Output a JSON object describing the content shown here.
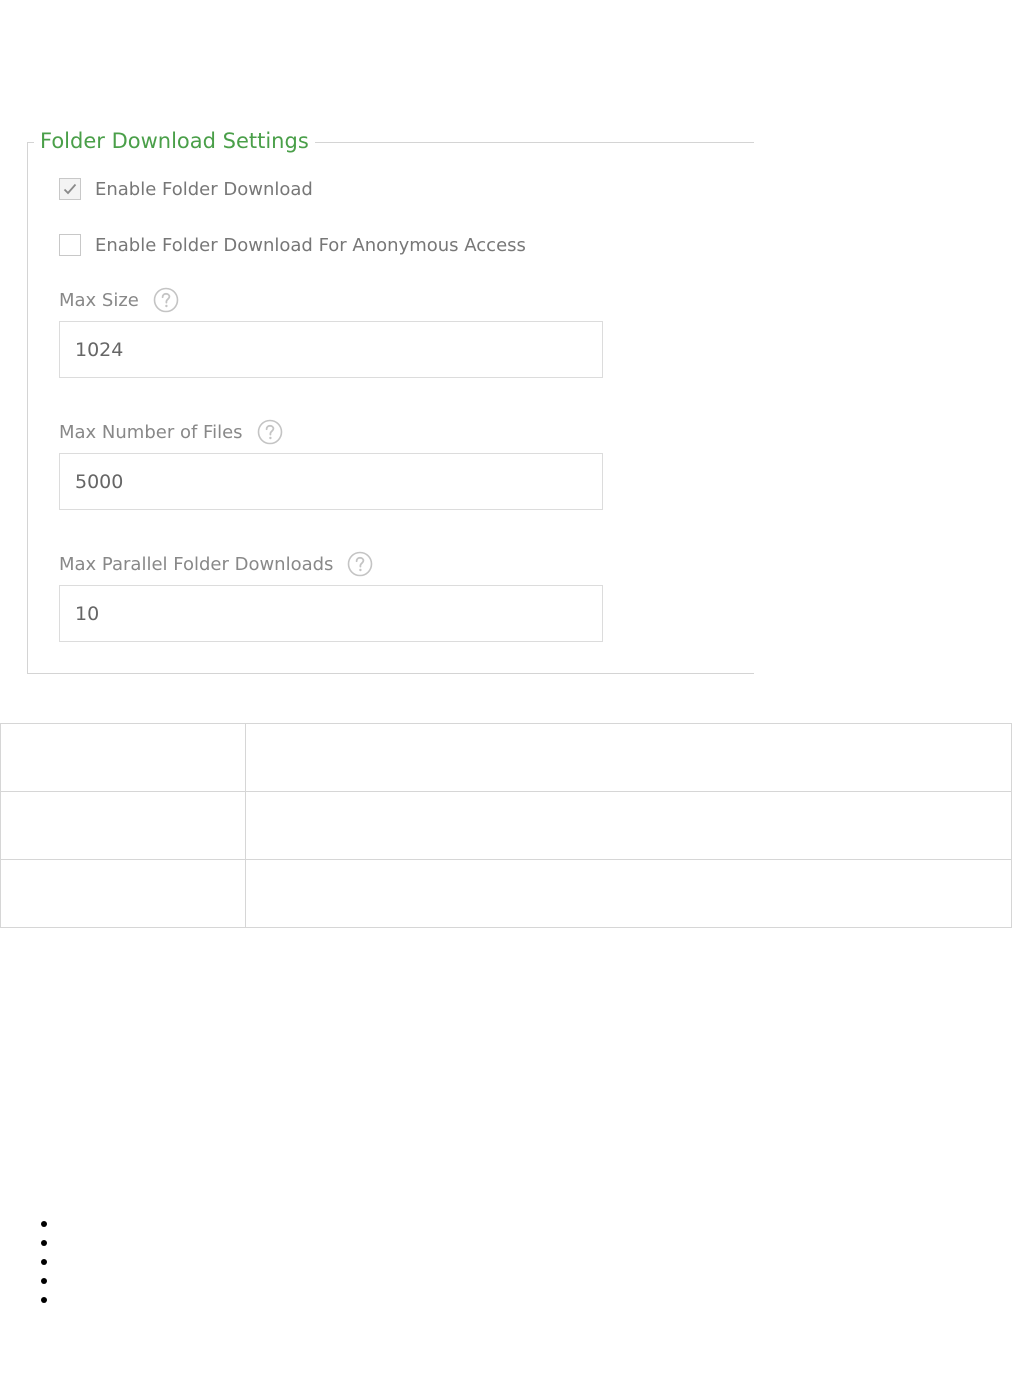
{
  "settings": {
    "legend": "Folder Download Settings",
    "enable_folder_download": {
      "label": "Enable Folder Download",
      "checked": true
    },
    "enable_anonymous": {
      "label": "Enable Folder Download For Anonymous Access",
      "checked": false
    },
    "max_size": {
      "label": "Max Size",
      "value": "1024"
    },
    "max_files": {
      "label": "Max Number of Files",
      "value": "5000"
    },
    "max_parallel": {
      "label": "Max Parallel Folder Downloads",
      "value": "10"
    }
  },
  "table": {
    "rows": [
      [
        "",
        ""
      ],
      [
        "",
        ""
      ],
      [
        "",
        ""
      ]
    ]
  },
  "bullets": [
    "",
    "",
    "",
    "",
    ""
  ],
  "colors": {
    "legend_green": "#4a9f49",
    "border_gray": "#d4d4d4"
  },
  "icons": {
    "check": "check-icon",
    "help": "help-circle-icon"
  }
}
